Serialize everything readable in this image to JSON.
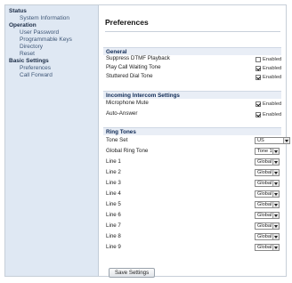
{
  "sidebar": {
    "sections": [
      {
        "label": "Status",
        "items": [
          {
            "label": "System Information"
          }
        ]
      },
      {
        "label": "Operation",
        "items": [
          {
            "label": "User Password"
          },
          {
            "label": "Programmable Keys"
          },
          {
            "label": "Directory"
          },
          {
            "label": "Reset"
          }
        ]
      },
      {
        "label": "Basic Settings",
        "items": [
          {
            "label": "Preferences"
          },
          {
            "label": "Call Forward"
          }
        ]
      }
    ]
  },
  "page": {
    "title": "Preferences",
    "general": {
      "heading": "General",
      "rows": [
        {
          "label": "Suppress DTMF Playback",
          "option": "Enabled",
          "checked": false
        },
        {
          "label": "Play Call Waiting Tone",
          "option": "Enabled",
          "checked": true
        },
        {
          "label": "Stuttered Dial Tone",
          "option": "Enabled",
          "checked": true
        }
      ]
    },
    "intercom": {
      "heading": "Incoming Intercom Settings",
      "rows": [
        {
          "label": "Microphone Mute",
          "option": "Enabled",
          "checked": true
        },
        {
          "label": "Auto-Answer",
          "option": "Enabled",
          "checked": true
        }
      ]
    },
    "ringtones": {
      "heading": "Ring Tones",
      "tone_set": {
        "label": "Tone Set",
        "value": "US"
      },
      "global": {
        "label": "Global Ring Tone",
        "value": "Tone 1"
      },
      "lines": [
        {
          "label": "Line 1",
          "value": "Global"
        },
        {
          "label": "Line 2",
          "value": "Global"
        },
        {
          "label": "Line 3",
          "value": "Global"
        },
        {
          "label": "Line 4",
          "value": "Global"
        },
        {
          "label": "Line 5",
          "value": "Global"
        },
        {
          "label": "Line 6",
          "value": "Global"
        },
        {
          "label": "Line 7",
          "value": "Global"
        },
        {
          "label": "Line 8",
          "value": "Global"
        },
        {
          "label": "Line 9",
          "value": "Global"
        }
      ]
    },
    "save_label": "Save Settings"
  }
}
